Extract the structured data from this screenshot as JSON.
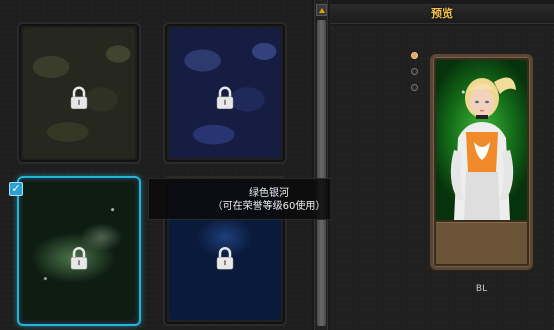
{
  "grid": {
    "cards": [
      {
        "name": "camo-olive",
        "locked": true,
        "selected": false
      },
      {
        "name": "camo-blue",
        "locked": true,
        "selected": false
      },
      {
        "name": "green-galaxy",
        "locked": true,
        "selected": true
      },
      {
        "name": "blue-pattern",
        "locked": true,
        "selected": false
      }
    ]
  },
  "tooltip": {
    "title": "绿色银河",
    "subtitle": "（可在荣誉等级60使用）"
  },
  "preview": {
    "title": "预览",
    "character_name": "BL",
    "page_dots": 3,
    "active_dot": 0
  },
  "colors": {
    "selection_border": "#27b5d6",
    "header_text": "#f2c24a",
    "frame_border": "#5a4636"
  },
  "icons": {
    "lock": "lock-icon",
    "check": "checkmark-icon",
    "scroll_up": "arrow-up-icon"
  }
}
